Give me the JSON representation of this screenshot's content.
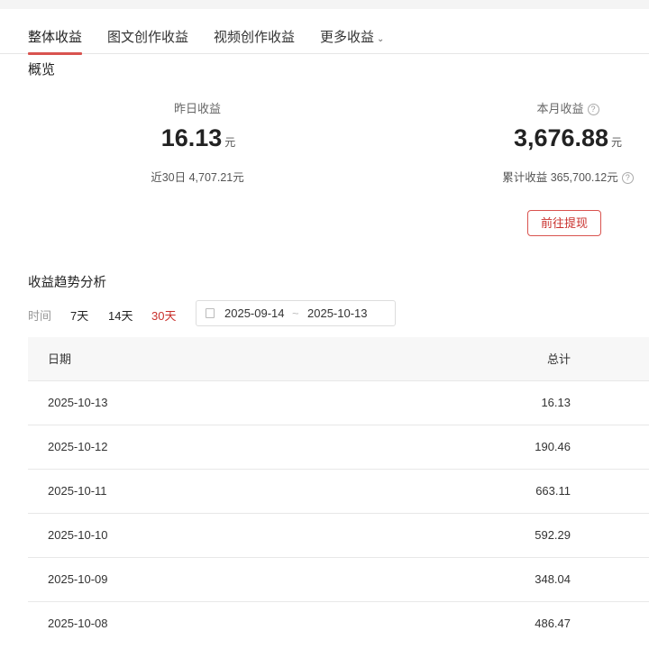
{
  "tabs": [
    {
      "label": "整体收益",
      "active": true
    },
    {
      "label": "图文创作收益"
    },
    {
      "label": "视频创作收益"
    },
    {
      "label": "更多收益"
    }
  ],
  "overview": {
    "title": "概览",
    "yesterday": {
      "label": "昨日收益",
      "value": "16.13",
      "unit": "元",
      "sub": "近30日 4,707.21元"
    },
    "month": {
      "label": "本月收益",
      "value": "3,676.88",
      "unit": "元",
      "sub": "累计收益 365,700.12元"
    },
    "help_icon": "?",
    "withdraw_label": "前往提现"
  },
  "trend": {
    "title": "收益趋势分析",
    "time_label": "时间",
    "options": [
      "7天",
      "14天",
      "30天"
    ],
    "selected": "30天",
    "start": "2025-09-14",
    "sep": "~",
    "end": "2025-10-13"
  },
  "table": {
    "headers": [
      "日期",
      "总计"
    ],
    "rows": [
      [
        "2025-10-13",
        "16.13"
      ],
      [
        "2025-10-12",
        "190.46"
      ],
      [
        "2025-10-11",
        "663.11"
      ],
      [
        "2025-10-10",
        "592.29"
      ],
      [
        "2025-10-09",
        "348.04"
      ],
      [
        "2025-10-08",
        "486.47"
      ]
    ]
  },
  "colors": {
    "accent": "#d9534f"
  }
}
